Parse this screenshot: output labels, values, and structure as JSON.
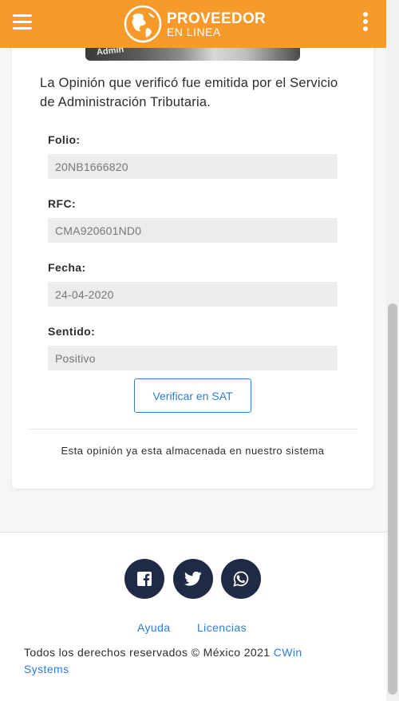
{
  "header": {
    "logo_line1": "PROVEEDOR",
    "logo_line2": "EN LINEA",
    "accent_color": "#f79a2a",
    "menu_icon": "hamburger-icon",
    "options_icon": "kebab-menu-icon"
  },
  "card": {
    "image_text": "Admin",
    "intro": "La Opinión que verificó fue emitida por el Servicio de Administración Tributaria.",
    "fields": [
      {
        "label": "Folio:",
        "value": "20NB1666820"
      },
      {
        "label": "RFC:",
        "value": "CMA920601ND0"
      },
      {
        "label": "Fecha:",
        "value": "24-04-2020"
      },
      {
        "label": "Sentido:",
        "value": "Positivo"
      }
    ],
    "verify_button": "Verificar en SAT",
    "stored_message": "Esta opinión ya esta almacenada en nuestro sistema"
  },
  "footer": {
    "social": [
      {
        "icon": "facebook-icon"
      },
      {
        "icon": "twitter-icon"
      },
      {
        "icon": "whatsapp-icon"
      }
    ],
    "links": [
      "Ayuda",
      "Licencias"
    ],
    "copyright_text": "Todos los derechos reservados © México 2021 ",
    "brand": "CWin Systems",
    "link_color": "#2d7fd1"
  }
}
